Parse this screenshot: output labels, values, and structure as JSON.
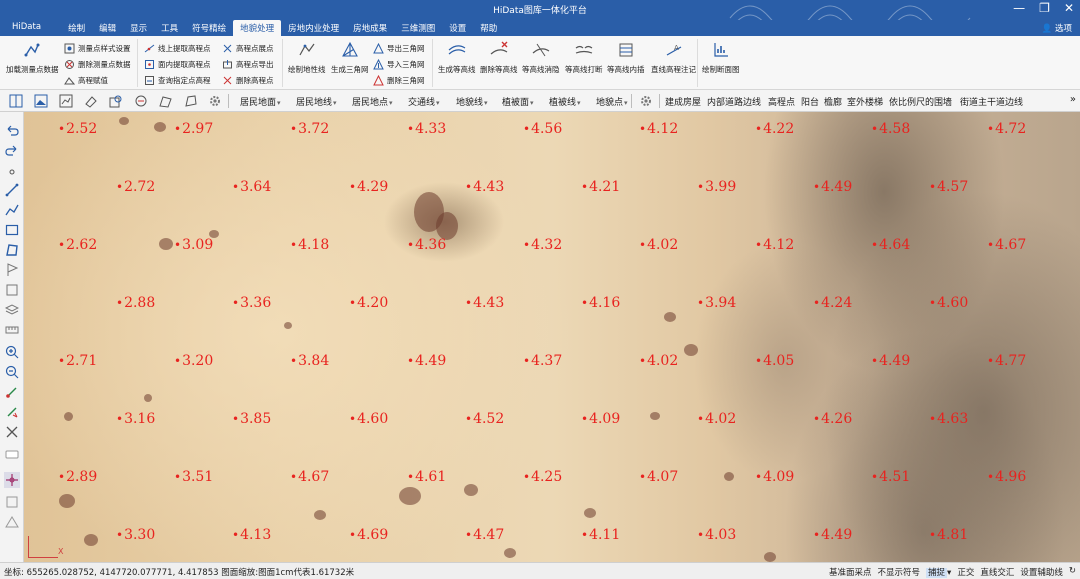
{
  "window": {
    "title": "HiData图库一体化平台",
    "minimize": "—",
    "restore": "❐",
    "close": "✕"
  },
  "menu": {
    "app_label": "HiData",
    "items": [
      "绘制",
      "编辑",
      "显示",
      "工具",
      "符号精绘",
      "地貌处理",
      "房地内业处理",
      "房地成果",
      "三维测图",
      "设置",
      "帮助"
    ],
    "active_index": 5,
    "options_label": "选项"
  },
  "ribbon": {
    "load_points": "加载测量点数据",
    "g1": [
      "测量点样式设置",
      "删除测量点数据",
      "高程赋值"
    ],
    "g2": [
      "线上提取高程点",
      "面内提取高程点",
      "查询指定点高程"
    ],
    "g3": [
      "高程点展点",
      "高程点导出",
      "删除高程点"
    ],
    "draw_terrain_line": "绘制地性线",
    "gen_triangle": "生成三角网",
    "g4": [
      "导出三角网",
      "导入三角网",
      "删除三角网"
    ],
    "contour": [
      "生成等高线",
      "删除等高线",
      "等高线消隐",
      "等高线打断",
      "等高线内插",
      "直线高程注记"
    ],
    "draw_section": "绘制断面图"
  },
  "toolbar": {
    "dropdowns": [
      "居民地面",
      "居民地线",
      "居民地点",
      "交通线",
      "地貌线",
      "植被面",
      "植被线",
      "地貌点"
    ],
    "labels": [
      "建成房屋",
      "内部道路边线",
      "高程点",
      "阳台",
      "檐廊",
      "室外楼梯",
      "依比例尺的围墙",
      "街道主干道边线"
    ],
    "more": "»"
  },
  "map": {
    "elevations": [
      [
        "2.52",
        "2.97",
        "3.72",
        "4.33",
        "4.56",
        "4.12",
        "4.22",
        "4.58",
        "4.72"
      ],
      [
        "2.72",
        "3.64",
        "4.29",
        "4.43",
        "4.21",
        "3.99",
        "4.49",
        "4.57"
      ],
      [
        "2.62",
        "3.09",
        "4.18",
        "4.36",
        "4.32",
        "4.02",
        "4.12",
        "4.64",
        "4.67"
      ],
      [
        "2.88",
        "3.36",
        "4.20",
        "4.43",
        "4.16",
        "3.94",
        "4.24",
        "4.60"
      ],
      [
        "2.71",
        "3.20",
        "3.84",
        "4.49",
        "4.37",
        "4.02",
        "4.05",
        "4.49",
        "4.77"
      ],
      [
        "3.16",
        "3.85",
        "4.60",
        "4.52",
        "4.09",
        "4.02",
        "4.26",
        "4.63"
      ],
      [
        "2.89",
        "3.51",
        "4.67",
        "4.61",
        "4.25",
        "4.07",
        "4.09",
        "4.51",
        "4.96"
      ],
      [
        "3.30",
        "4.13",
        "4.69",
        "4.47",
        "4.11",
        "4.03",
        "4.49",
        "4.81"
      ]
    ],
    "axis_x": "X"
  },
  "status": {
    "coords": "坐标: 655265.028752, 4147720.077771, 4.417853  图面缩放:图面1cm代表1.61732米",
    "items": [
      "基准面采点",
      "不显示符号",
      "捕捉",
      "正交",
      "直线交汇",
      "设置辅助线"
    ],
    "highlight_index": 2,
    "caret": "▾"
  },
  "colors": {
    "title_bar": "#2a5ea8",
    "elevation_text": "#e8231f"
  }
}
